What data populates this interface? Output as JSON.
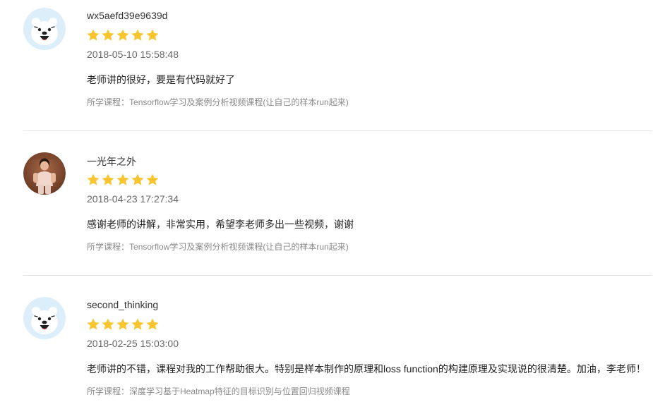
{
  "colors": {
    "star": "#f9c52e",
    "divider": "#e5e5e5",
    "avatar_bg": "#dbeefa"
  },
  "reviews": [
    {
      "username": "wx5aefd39e9639d",
      "avatar": "bear-avatar-icon",
      "rating": 5,
      "max_rating": 5,
      "date": "2018-05-10 15:58:48",
      "comment": "老师讲的很好，要是有代码就好了",
      "course_prefix": "所学课程：",
      "course": "Tensorflow学习及案例分析视频课程(让自己的样本run起来)"
    },
    {
      "username": "一光年之外",
      "avatar": "child-photo-avatar",
      "rating": 5,
      "max_rating": 5,
      "date": "2018-04-23 17:27:34",
      "comment": "感谢老师的讲解，非常实用，希望李老师多出一些视频，谢谢",
      "course_prefix": "所学课程：",
      "course": "Tensorflow学习及案例分析视频课程(让自己的样本run起来)"
    },
    {
      "username": "second_thinking",
      "avatar": "bear-avatar-icon",
      "rating": 5,
      "max_rating": 5,
      "date": "2018-02-25 15:03:00",
      "comment": "老师讲的不错，课程对我的工作帮助很大。特别是样本制作的原理和loss function的构建原理及实现说的很清楚。加油，李老师！",
      "course_prefix": "所学课程：",
      "course": "深度学习基于Heatmap特征的目标识别与位置回归视频课程"
    }
  ]
}
